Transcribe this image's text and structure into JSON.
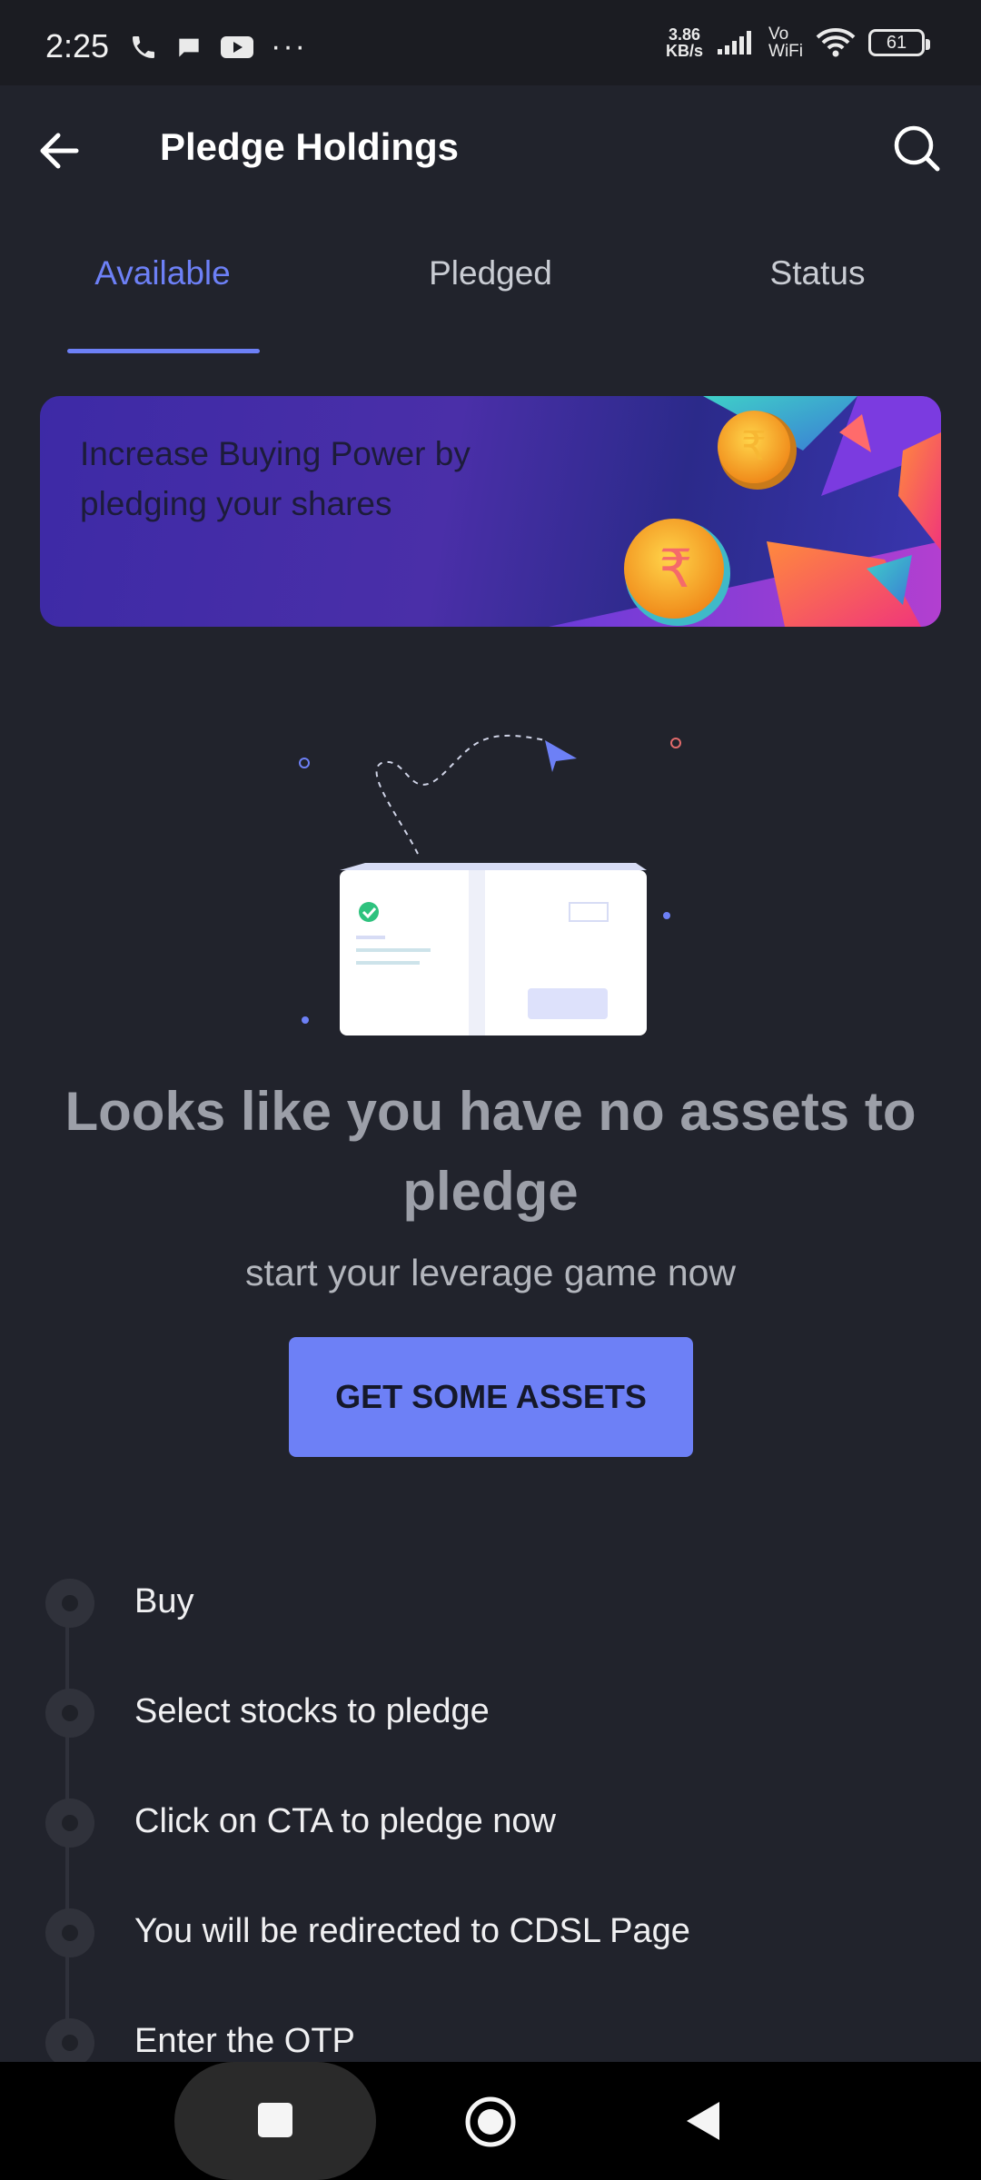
{
  "status_bar": {
    "time": "2:25",
    "net_speed_value": "3.86",
    "net_speed_unit": "KB/s",
    "vo_label": "Vo",
    "wifi_label": "WiFi",
    "battery": "61",
    "overflow": "···"
  },
  "header": {
    "title": "Pledge Holdings",
    "back_icon": "arrow-left-icon",
    "search_icon": "search-icon"
  },
  "tabs": [
    {
      "label": "Available",
      "active": true
    },
    {
      "label": "Pledged",
      "active": false
    },
    {
      "label": "Status",
      "active": false
    }
  ],
  "banner": {
    "text": "Increase Buying Power by pledging your shares"
  },
  "empty_state": {
    "title": "Looks like you have no assets to pledge",
    "subtitle": "start your leverage game now",
    "cta": "GET SOME ASSETS"
  },
  "steps": [
    {
      "label": "Buy"
    },
    {
      "label": "Select stocks to pledge"
    },
    {
      "label": "Click on CTA to pledge now"
    },
    {
      "label": "You will be redirected to CDSL Page"
    },
    {
      "label": "Enter the OTP"
    }
  ],
  "colors": {
    "background": "#21232c",
    "accent": "#6d80f6",
    "muted_text": "#9c9fa8"
  }
}
